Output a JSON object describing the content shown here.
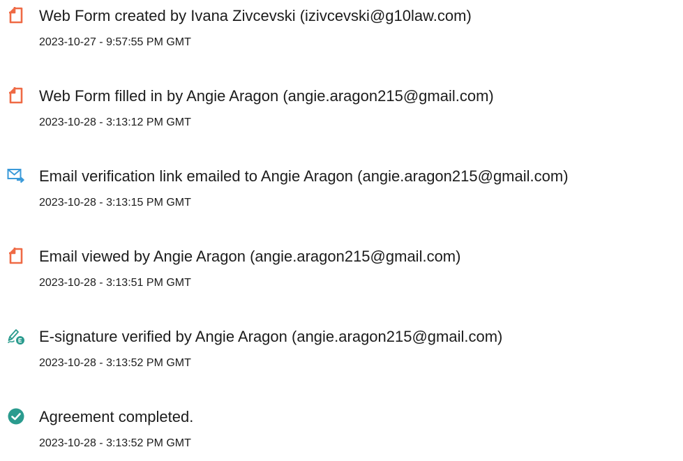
{
  "colors": {
    "document_icon": "#ef6a45",
    "email_icon": "#3a9ad9",
    "check_icon": "#2a9b8e",
    "text": "#1c1c1c"
  },
  "events": [
    {
      "icon": "document-icon",
      "description": "Web Form created by Ivana Zivcevski (izivcevski@g10law.com)",
      "timestamp": "2023-10-27 - 9:57:55 PM GMT"
    },
    {
      "icon": "document-icon",
      "description": "Web Form filled in by Angie Aragon (angie.aragon215@gmail.com)",
      "timestamp": "2023-10-28 - 3:13:12 PM GMT"
    },
    {
      "icon": "email-forward-icon",
      "description": "Email verification link emailed to Angie Aragon (angie.aragon215@gmail.com)",
      "timestamp": "2023-10-28 - 3:13:15 PM GMT"
    },
    {
      "icon": "document-icon",
      "description": "Email viewed by Angie Aragon (angie.aragon215@gmail.com)",
      "timestamp": "2023-10-28 - 3:13:51 PM GMT"
    },
    {
      "icon": "signature-verified-icon",
      "description": "E-signature verified by Angie Aragon (angie.aragon215@gmail.com)",
      "timestamp": "2023-10-28 - 3:13:52 PM GMT"
    },
    {
      "icon": "check-circle-icon",
      "description": "Agreement completed.",
      "timestamp": "2023-10-28 - 3:13:52 PM GMT"
    }
  ]
}
